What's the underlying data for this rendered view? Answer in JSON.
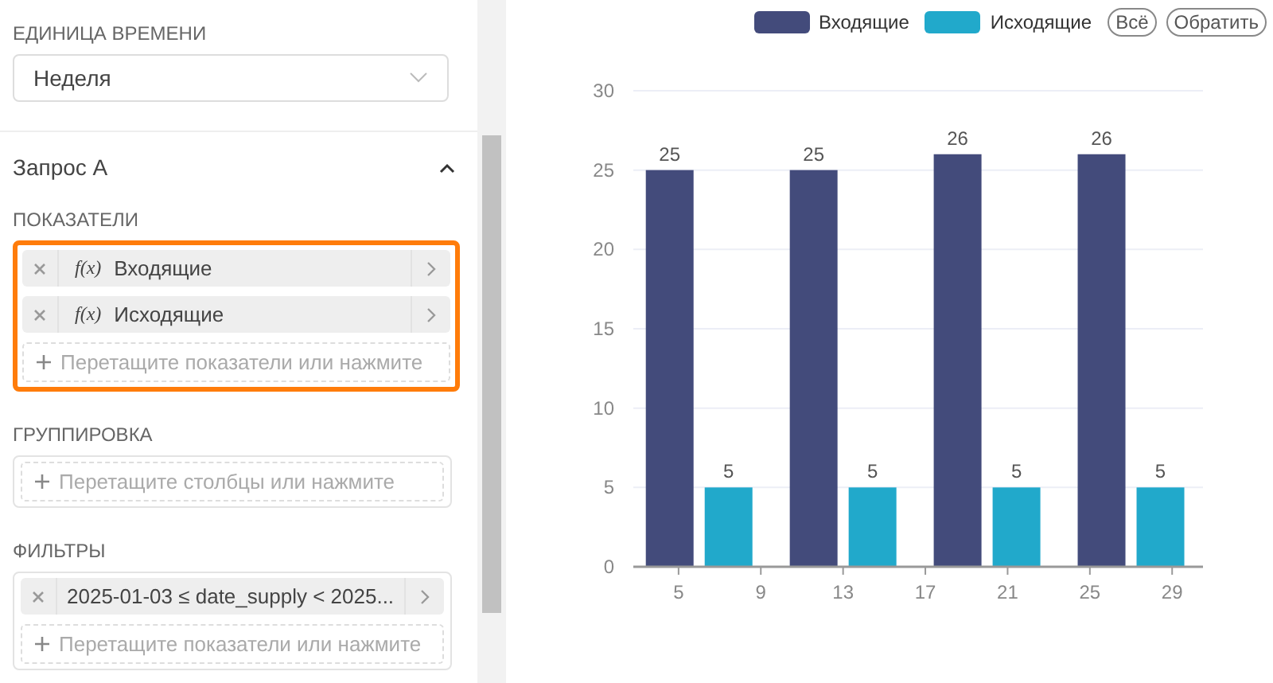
{
  "time_unit": {
    "label": "ЕДИНИЦА ВРЕМЕНИ",
    "value": "Неделя"
  },
  "query": {
    "title": "Запрос A",
    "expanded": true
  },
  "metrics": {
    "label": "ПОКАЗАТЕЛИ",
    "highlighted": true,
    "items": [
      {
        "icon": "f(x)",
        "name": "Входящие"
      },
      {
        "icon": "f(x)",
        "name": "Исходящие"
      }
    ],
    "add_hint": "Перетащите показатели или нажмите"
  },
  "grouping": {
    "label": "ГРУППИРОВКА",
    "add_hint": "Перетащите столбцы или нажмите"
  },
  "filters": {
    "label": "ФИЛЬТРЫ",
    "items": [
      {
        "text": "2025-01-03 ≤ date_supply < 2025..."
      }
    ],
    "add_hint": "Перетащите показатели или нажмите"
  },
  "legend": {
    "buttons": [
      "Всё",
      "Обратить"
    ]
  },
  "chart_data": {
    "type": "bar",
    "x": [
      6,
      13,
      20,
      27
    ],
    "series": [
      {
        "name": "Входящие",
        "color": "#434b7b",
        "values": [
          25,
          25,
          26,
          26
        ]
      },
      {
        "name": "Исходящие",
        "color": "#21a9cb",
        "values": [
          5,
          5,
          5,
          5
        ]
      }
    ],
    "xlim": [
      2.8,
      30.5
    ],
    "ylim": [
      0,
      30
    ],
    "xticks": [
      5,
      9,
      13,
      17,
      21,
      25,
      29
    ],
    "yticks": [
      0,
      5,
      10,
      15,
      20,
      25,
      30
    ],
    "data_labels": true,
    "grid": true
  }
}
